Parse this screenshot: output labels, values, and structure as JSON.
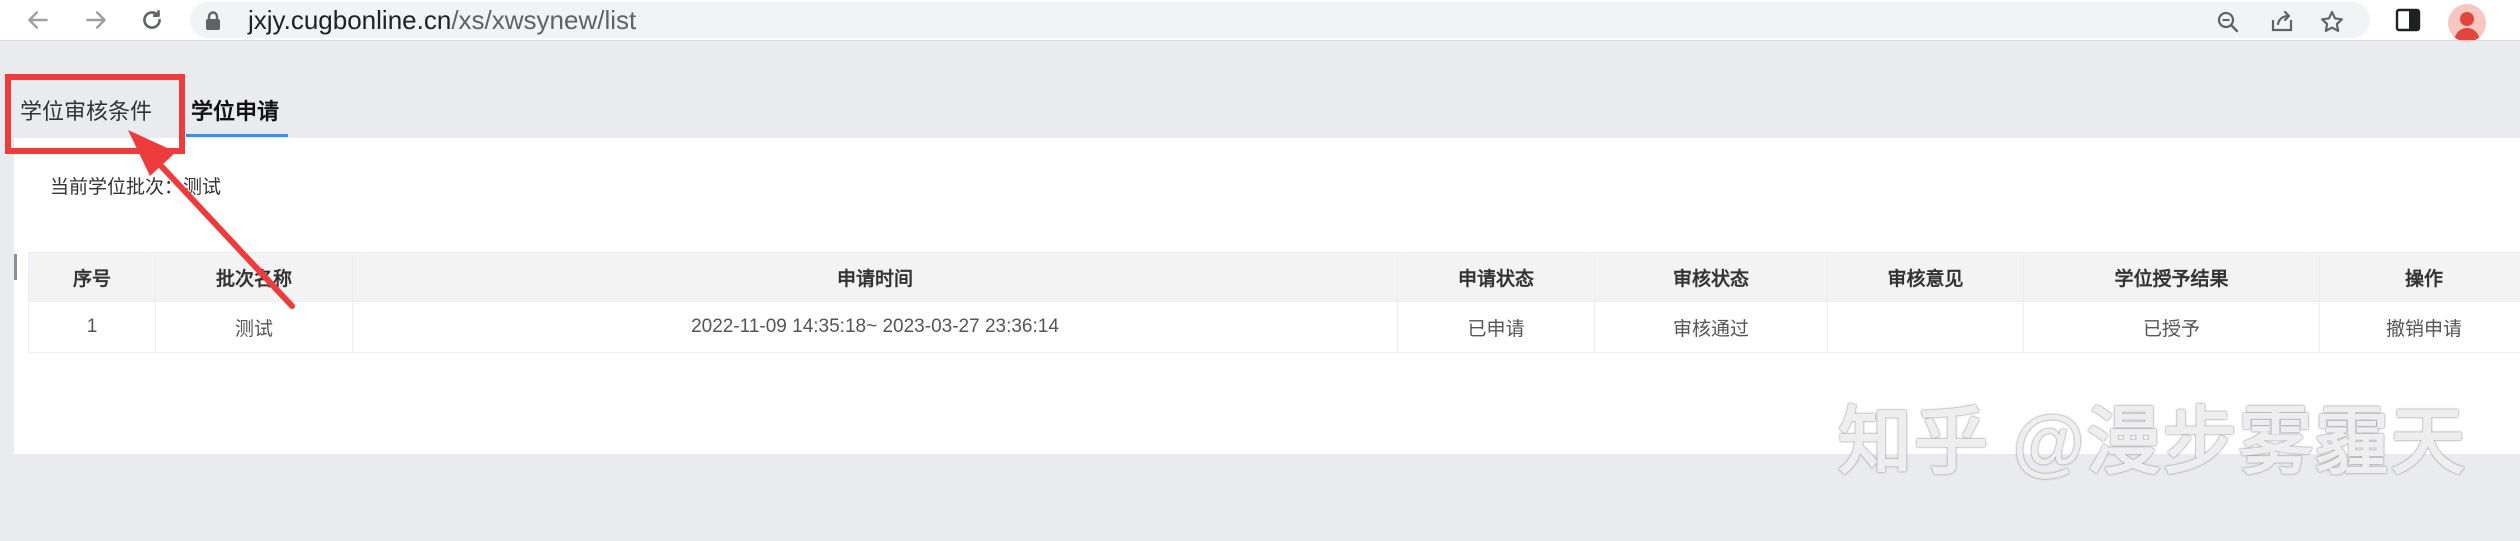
{
  "browser": {
    "url_host": "jxjy.cugbonline.cn",
    "url_path": "/xs/xwsynew/list"
  },
  "tabs": [
    {
      "label": "学位审核条件"
    },
    {
      "label": "学位申请"
    }
  ],
  "batch": {
    "text": "当前学位批次：测试"
  },
  "table": {
    "headers": [
      "序号",
      "批次名称",
      "申请时间",
      "申请状态",
      "审核状态",
      "审核意见",
      "学位授予结果",
      "操作"
    ],
    "rows": [
      {
        "index": "1",
        "batch_name": "测试",
        "apply_time": "2022-11-09 14:35:18~ 2023-03-27 23:36:14",
        "apply_status": "已申请",
        "review_status": "审核通过",
        "review_opinion": "",
        "result": "已授予",
        "action": "撤销申请"
      }
    ]
  },
  "watermark": "知乎 @漫步雾霾天",
  "colors": {
    "annotation_red": "#ee3b3b",
    "tab_underline": "#3a8ee6",
    "granted_text": "#1d3ea8"
  }
}
